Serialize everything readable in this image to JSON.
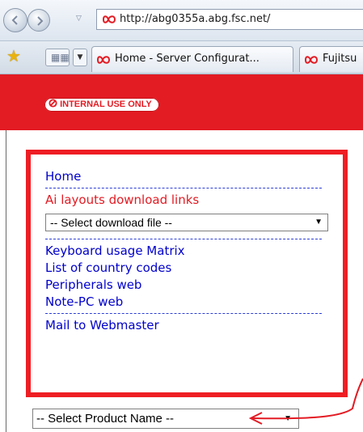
{
  "browser": {
    "url": "http://abg0355a.abg.fsc.net/",
    "tabs": [
      {
        "label": "Home - Server Configurat..."
      },
      {
        "label": "Fujitsu"
      }
    ]
  },
  "page": {
    "badge": "INTERNAL USE ONLY",
    "menu": {
      "home": "Home",
      "ai_layouts": "Ai layouts download links",
      "download_select": "-- Select download file --",
      "links": [
        "Keyboard usage Matrix",
        "List of country codes",
        "Peripherals web",
        "Note-PC web"
      ],
      "mail": "Mail to Webmaster"
    },
    "product_select": "-- Select Product Name --"
  },
  "colors": {
    "brand_red": "#e31b23",
    "annotation_red": "#ee1d23",
    "link_blue": "#0000cc"
  }
}
